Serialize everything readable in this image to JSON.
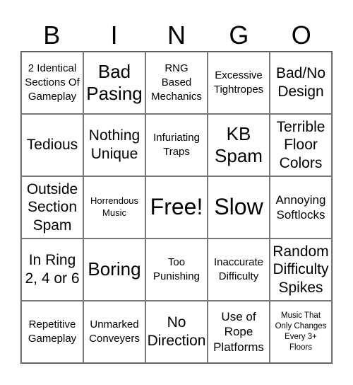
{
  "card": {
    "header": [
      "B",
      "I",
      "N",
      "G",
      "O"
    ],
    "rows": [
      [
        {
          "text": "2 Identical Sections Of Gameplay",
          "size": "s-md"
        },
        {
          "text": "Bad Pasing",
          "size": "s-xxl"
        },
        {
          "text": "RNG Based Mechanics",
          "size": "s-md"
        },
        {
          "text": "Excessive Tightropes",
          "size": "s-md"
        },
        {
          "text": "Bad/No Design",
          "size": "s-xl"
        }
      ],
      [
        {
          "text": "Tedious",
          "size": "s-xl"
        },
        {
          "text": "Nothing Unique",
          "size": "s-xl"
        },
        {
          "text": "Infuriating Traps",
          "size": "s-md"
        },
        {
          "text": "KB Spam",
          "size": "s-xxl"
        },
        {
          "text": "Terrible Floor Colors",
          "size": "s-xl"
        }
      ],
      [
        {
          "text": "Outside Section Spam",
          "size": "s-xl"
        },
        {
          "text": "Horrendous Music",
          "size": "s-sm"
        },
        {
          "text": "Free!",
          "size": "s-free"
        },
        {
          "text": "Slow",
          "size": "s-free"
        },
        {
          "text": "Annoying Softlocks",
          "size": "s-lg"
        }
      ],
      [
        {
          "text": "In Ring 2, 4 or 6",
          "size": "s-xl"
        },
        {
          "text": "Boring",
          "size": "s-xxl"
        },
        {
          "text": "Too Punishing",
          "size": "s-md"
        },
        {
          "text": "Inaccurate Difficulty",
          "size": "s-md"
        },
        {
          "text": "Random Difficulty Spikes",
          "size": "s-xl"
        }
      ],
      [
        {
          "text": "Repetitive Gameplay",
          "size": "s-md"
        },
        {
          "text": "Unmarked Conveyers",
          "size": "s-md"
        },
        {
          "text": "No Direction",
          "size": "s-xl"
        },
        {
          "text": "Use of Rope Platforms",
          "size": "s-lg"
        },
        {
          "text": "Music That Only Changes Every 3+ Floors",
          "size": "s-xs"
        }
      ]
    ]
  }
}
